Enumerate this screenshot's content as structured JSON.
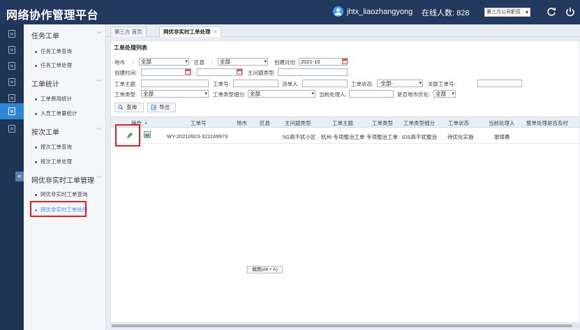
{
  "app": {
    "title": "网络协作管理平台"
  },
  "header": {
    "username": "jhtx_liaozhangyong",
    "online_label": "在线人数:",
    "online_count": "828",
    "role": "第三方公司职员"
  },
  "rail": {
    "active_index": 6
  },
  "sidebar": {
    "groups": [
      {
        "title": "任务工单",
        "items": [
          "任务工单查询",
          "任务工单处理"
        ]
      },
      {
        "title": "工单统计",
        "items": [
          "工单费用统计",
          "人员工单量统计"
        ]
      },
      {
        "title": "按次工单",
        "items": [
          "按次工单查询",
          "按次工单处理"
        ]
      },
      {
        "title": "网优非实时工单管理",
        "items": [
          "网优非实时工单查询",
          "网优非实时工单处理"
        ]
      }
    ],
    "collapse_glyph": "«"
  },
  "tabs": [
    {
      "label": "第三方 首页",
      "active": false
    },
    {
      "label": "网优非实时工单处理",
      "active": true,
      "close": "×"
    }
  ],
  "panel": {
    "title": "工单处理列表",
    "filters": {
      "city_label": "地市",
      "city_value": "全部",
      "county_label": "区县",
      "county_value": "全部",
      "month_label": "创建月份:",
      "month_value": "2021-10",
      "created_label": "创建时间:",
      "created_sep": "-",
      "problem_type_label": "主问题类型:",
      "subject_label": "工单主题:",
      "order_no_label": "工单号:",
      "dispatcher_label": "派单人:",
      "status_label": "工单状态:",
      "status_value": "-全部-",
      "related_no_label": "关联工单号:",
      "order_type_label": "工单类型:",
      "order_type_value": "全部",
      "type_detail_label": "工单类型细分:",
      "type_detail_value": "全部",
      "handler_label": "当前处理人:",
      "local_opt_label": "是否地市优化:",
      "local_opt_value": "全部"
    },
    "buttons": {
      "query": "查询",
      "export": "导出"
    },
    "columns": [
      "操作",
      "工单号",
      "地市",
      "区县",
      "主问题类型",
      "工单主题",
      "工单类型",
      "工单类型细分",
      "工单状态",
      "当前处理人",
      "整单处理是否及时"
    ],
    "rows": [
      {
        "order_no": "WY-20210923-322169973",
        "city": "",
        "county": "",
        "problem_type": "5G高干扰小区",
        "subject": "杭州-专项整治工单",
        "order_type": "专项整治工单",
        "type_detail": "IDS高干扰整治",
        "status": "待优化实施",
        "handler": "廖璋勇",
        "timely": ""
      }
    ],
    "tooltip": "截图(Alt + A)"
  },
  "colors": {
    "topbar": "#233a5e",
    "accent": "#2f86d6",
    "highlight": "#e02020",
    "active_link": "#4a8fe7"
  }
}
